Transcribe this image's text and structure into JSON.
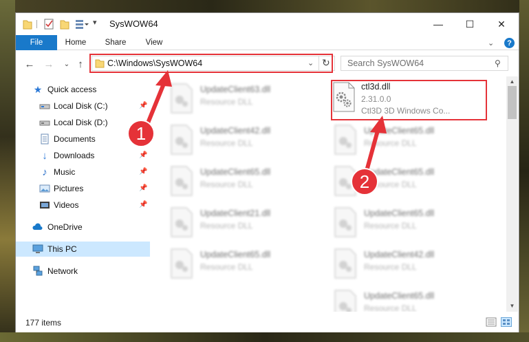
{
  "window": {
    "title": "SysWOW64",
    "minimize_label": "—",
    "maximize_label": "☐",
    "close_label": "✕"
  },
  "ribbon": {
    "tabs": [
      "File",
      "Home",
      "Share",
      "View"
    ],
    "help_label": "?"
  },
  "navigation": {
    "address_path": "C:\\Windows\\SysWOW64",
    "search_placeholder": "Search SysWOW64"
  },
  "sidebar": {
    "items": [
      {
        "label": "Quick access",
        "icon": "star-icon",
        "pinned": false
      },
      {
        "label": "Local Disk (C:)",
        "icon": "drive-icon",
        "pinned": true
      },
      {
        "label": "Local Disk (D:)",
        "icon": "drive-icon",
        "pinned": false
      },
      {
        "label": "Documents",
        "icon": "documents-icon",
        "pinned": true
      },
      {
        "label": "Downloads",
        "icon": "download-icon",
        "pinned": true
      },
      {
        "label": "Music",
        "icon": "music-icon",
        "pinned": true
      },
      {
        "label": "Pictures",
        "icon": "pictures-icon",
        "pinned": true
      },
      {
        "label": "Videos",
        "icon": "videos-icon",
        "pinned": true
      },
      {
        "label": "OneDrive",
        "icon": "cloud-icon",
        "pinned": false
      },
      {
        "label": "This PC",
        "icon": "computer-icon",
        "pinned": false,
        "selected": true
      },
      {
        "label": "Network",
        "icon": "network-icon",
        "pinned": false
      }
    ]
  },
  "files": {
    "left_column": [
      {
        "name": "UpdateClient63.dll",
        "desc": "Resource DLL"
      },
      {
        "name": "UpdateClient42.dll",
        "desc": "Resource DLL"
      },
      {
        "name": "UpdateClient65.dll",
        "desc": "Resource DLL"
      },
      {
        "name": "UpdateClient21.dll",
        "desc": "Resource DLL"
      },
      {
        "name": "UpdateClient65.dll",
        "desc": "Resource DLL"
      }
    ],
    "highlighted": {
      "name": "ctl3d.dll",
      "version": "2.31.0.0",
      "desc": "Ctl3D 3D Windows Co..."
    },
    "right_column": [
      {
        "name": "UpdateClient65.dll",
        "desc": "Resource DLL"
      },
      {
        "name": "UpdateClient65.dll",
        "desc": "Resource DLL"
      },
      {
        "name": "UpdateClient65.dll",
        "desc": "Resource DLL"
      },
      {
        "name": "UpdateClient42.dll",
        "desc": "Resource DLL"
      },
      {
        "name": "UpdateClient65.dll",
        "desc": "Resource DLL"
      }
    ]
  },
  "status": {
    "item_count": "177 items"
  },
  "annotations": {
    "step1": "1",
    "step2": "2",
    "color": "#e53238"
  }
}
